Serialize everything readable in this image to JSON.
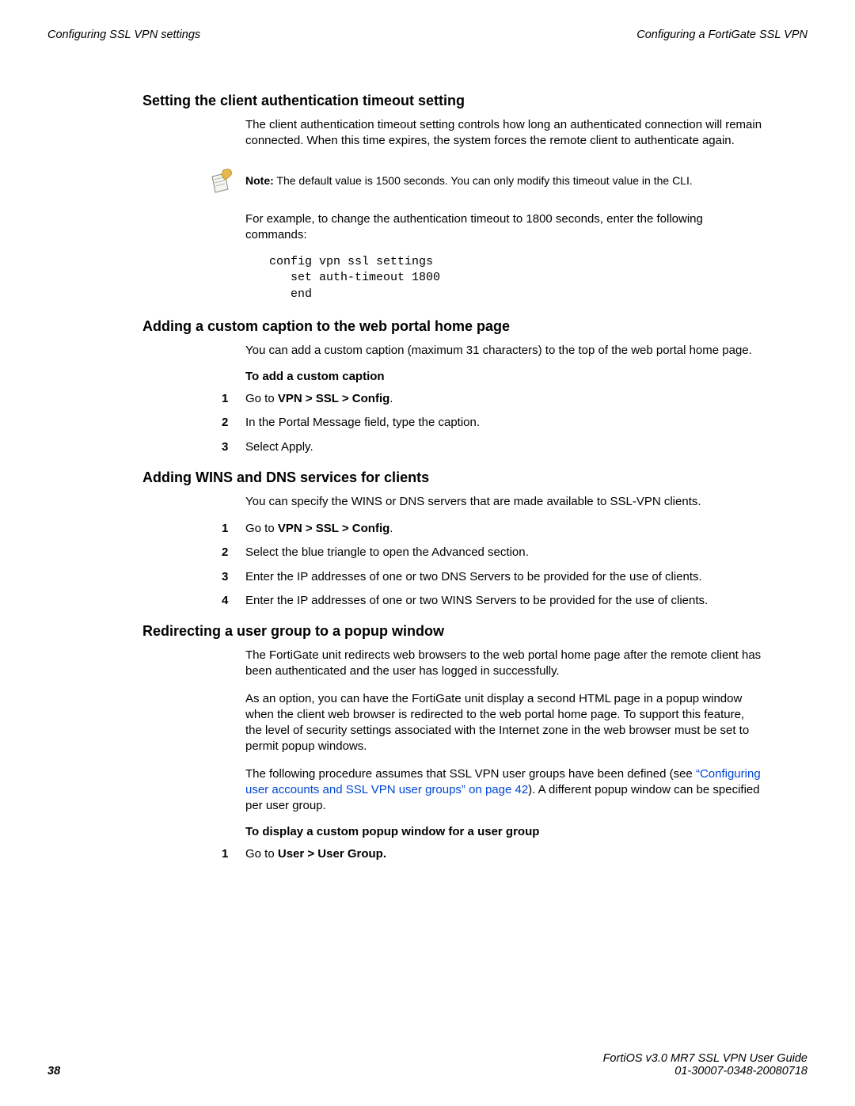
{
  "header": {
    "left": "Configuring SSL VPN settings",
    "right": "Configuring a FortiGate SSL VPN"
  },
  "section1": {
    "heading": "Setting the client authentication timeout setting",
    "p1": "The client authentication timeout setting controls how long an authenticated connection will remain connected. When this time expires, the system forces the remote client to authenticate again.",
    "note_label": "Note:",
    "note_text": " The default value is 1500 seconds. You can only modify this timeout value in the CLI.",
    "p2": "For example, to change the authentication timeout to 1800 seconds, enter the following commands:",
    "code": "config vpn ssl settings\n   set auth-timeout 1800\n   end"
  },
  "section2": {
    "heading": "Adding a custom caption to the web portal home page",
    "p1": "You can add a custom caption (maximum 31 characters) to the top of the web portal home page.",
    "sub": "To add a custom caption",
    "steps": [
      {
        "pre": "Go to ",
        "bold": "VPN > SSL > Config",
        "post": "."
      },
      {
        "text": "In the Portal Message field, type the caption."
      },
      {
        "text": "Select Apply."
      }
    ]
  },
  "section3": {
    "heading": "Adding WINS and DNS services for clients",
    "p1": "You can specify the WINS or DNS servers that are made available to SSL-VPN clients.",
    "steps": [
      {
        "pre": "Go to ",
        "bold": "VPN > SSL > Config",
        "post": "."
      },
      {
        "text": "Select the blue triangle to open the Advanced section."
      },
      {
        "text": "Enter the IP addresses of one or two DNS Servers to be provided for the use of clients."
      },
      {
        "text": "Enter the IP addresses of one or two WINS Servers to be provided for the use of clients."
      }
    ]
  },
  "section4": {
    "heading": "Redirecting a user group to a popup window",
    "p1": "The FortiGate unit redirects web browsers to the web portal home page after the remote client has been authenticated and the user has logged in successfully.",
    "p2": "As an option, you can have the FortiGate unit display a second HTML page in a popup window when the client web browser is redirected to the web portal home page. To support this feature, the level of security settings associated with the Internet zone in the web browser must be set to permit popup windows.",
    "p3_pre": "The following procedure assumes that SSL VPN user groups have been defined (see ",
    "p3_link": "“Configuring user accounts and SSL VPN user groups” on page 42",
    "p3_post": "). A different popup window can be specified per user group.",
    "sub": "To display a custom popup window for a user group",
    "steps": [
      {
        "pre": "Go to ",
        "bold": "User > User Group.",
        "post": ""
      }
    ]
  },
  "footer": {
    "page": "38",
    "line1": "FortiOS v3.0 MR7 SSL VPN User Guide",
    "line2": "01-30007-0348-20080718"
  }
}
